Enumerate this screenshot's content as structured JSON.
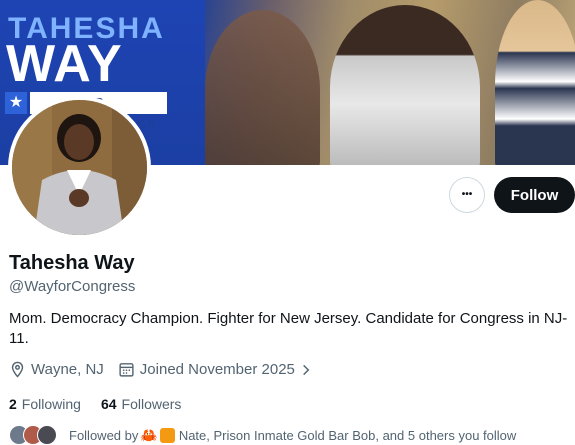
{
  "banner": {
    "brand_line1": "TAHESHA",
    "brand_line2": "WAY",
    "brand_line3": "FOR CONGRESS"
  },
  "profile": {
    "display_name": "Tahesha Way",
    "handle": "@WayforCongress",
    "bio": "Mom. Democracy Champion. Fighter for New Jersey. Candidate for Congress in NJ-11.",
    "location": "Wayne, NJ",
    "joined": "Joined November 2025",
    "following_count": "2",
    "following_label": "Following",
    "followers_count": "64",
    "followers_label": "Followers"
  },
  "actions": {
    "more_label": "•••",
    "follow_label": "Follow"
  },
  "followed_by": {
    "prefix": "Followed by",
    "names": "Nate, Prison Inmate Gold Bar Bob, and 5 others you follow"
  },
  "icons": {
    "more": "more-icon",
    "location": "location-pin-icon",
    "calendar": "calendar-icon",
    "chevron": "chevron-right-icon"
  },
  "colors": {
    "banner_blue": "#1d3e9c",
    "follow_button": "#0f1419",
    "secondary_text": "#536471"
  }
}
